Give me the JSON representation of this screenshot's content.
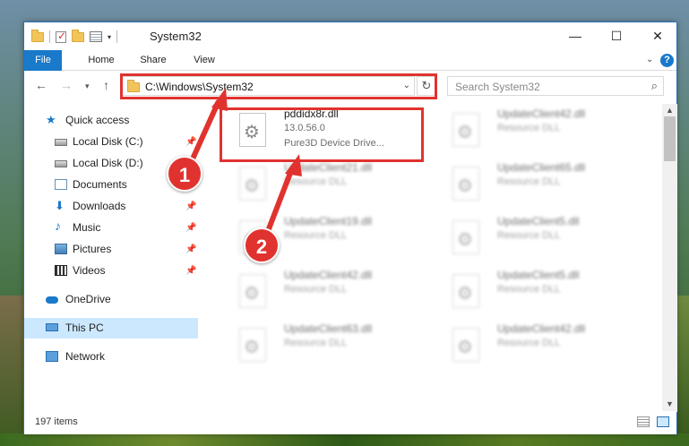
{
  "window": {
    "title": "System32"
  },
  "titlebar": {
    "minimize": "—",
    "maximize": "☐",
    "close": "✕"
  },
  "ribbon": {
    "tabs": [
      "File",
      "Home",
      "Share",
      "View"
    ],
    "help": "?"
  },
  "address": {
    "path": "C:\\Windows\\System32",
    "search_placeholder": "Search System32"
  },
  "nav": {
    "items": [
      {
        "label": "Quick access",
        "icon": "star-icon"
      },
      {
        "label": "Local Disk (C:)",
        "icon": "disk-icon",
        "pinned": true
      },
      {
        "label": "Local Disk (D:)",
        "icon": "disk-icon"
      },
      {
        "label": "Documents",
        "icon": "documents-icon"
      },
      {
        "label": "Downloads",
        "icon": "download-icon",
        "pinned": true
      },
      {
        "label": "Music",
        "icon": "music-icon",
        "pinned": true
      },
      {
        "label": "Pictures",
        "icon": "pictures-icon",
        "pinned": true
      },
      {
        "label": "Videos",
        "icon": "videos-icon",
        "pinned": true
      },
      {
        "label": "OneDrive",
        "icon": "cloud-icon"
      },
      {
        "label": "This PC",
        "icon": "computer-icon",
        "selected": true
      },
      {
        "label": "Network",
        "icon": "network-icon"
      }
    ]
  },
  "files": {
    "selected": {
      "name": "pddidx8r.dll",
      "version": "13.0.56.0",
      "description": "Pure3D Device Drive..."
    },
    "others": [
      {
        "name": "UpdateClient42.dll",
        "type": "Resource DLL"
      },
      {
        "name": "UpdateClient21.dll",
        "type": "Resource DLL"
      },
      {
        "name": "UpdateClient65.dll",
        "type": "Resource DLL"
      },
      {
        "name": "UpdateClient19.dll",
        "type": "Resource DLL"
      },
      {
        "name": "UpdateClient5.dll",
        "type": "Resource DLL"
      },
      {
        "name": "UpdateClient42.dll",
        "type": "Resource DLL"
      },
      {
        "name": "UpdateClient5.dll",
        "type": "Resource DLL"
      },
      {
        "name": "UpdateClient63.dll",
        "type": "Resource DLL"
      },
      {
        "name": "UpdateClient42.dll",
        "type": "Resource DLL"
      }
    ]
  },
  "status": {
    "count": "197 items"
  },
  "annotations": {
    "step1": "1",
    "step2": "2",
    "color": "#e0332f"
  }
}
